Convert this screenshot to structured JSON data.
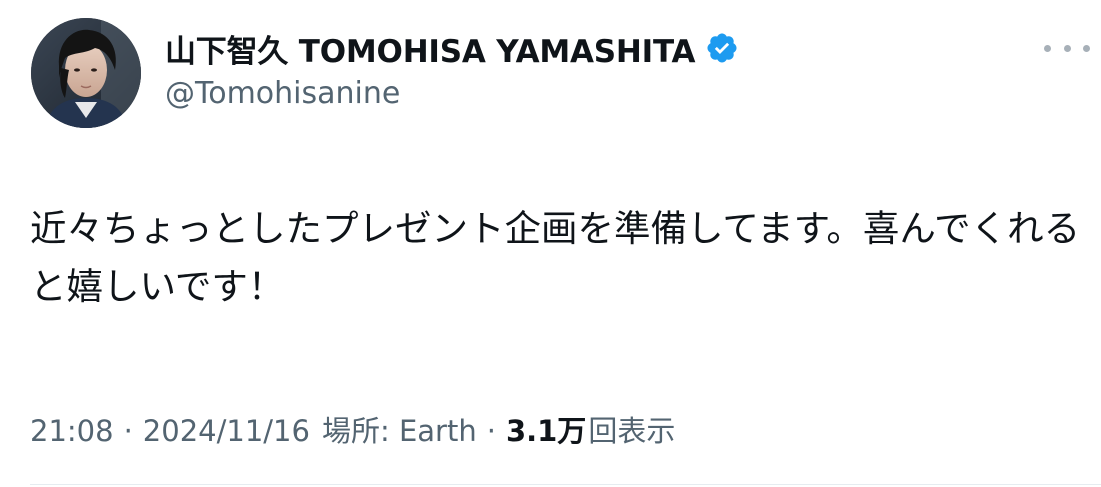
{
  "author": {
    "display_name": "山下智久 TOMOHISA YAMASHITA",
    "handle": "@Tomohisanine",
    "verified": true,
    "verified_color": "#1d9bf0",
    "avatar_icon": "profile-photo"
  },
  "tweet": {
    "text": "近々ちょっとしたプレゼント企画を準備してます。喜んでくれると嬉しいです！"
  },
  "meta": {
    "time": "21:08",
    "separator": "·",
    "date": "2024/11/16",
    "location_label": "場所: Earth",
    "views_count": "3.1万",
    "views_label": "回表示"
  },
  "colors": {
    "text_primary": "#0f1419",
    "text_secondary": "#536471",
    "more_dots": "#a7b0b8"
  }
}
